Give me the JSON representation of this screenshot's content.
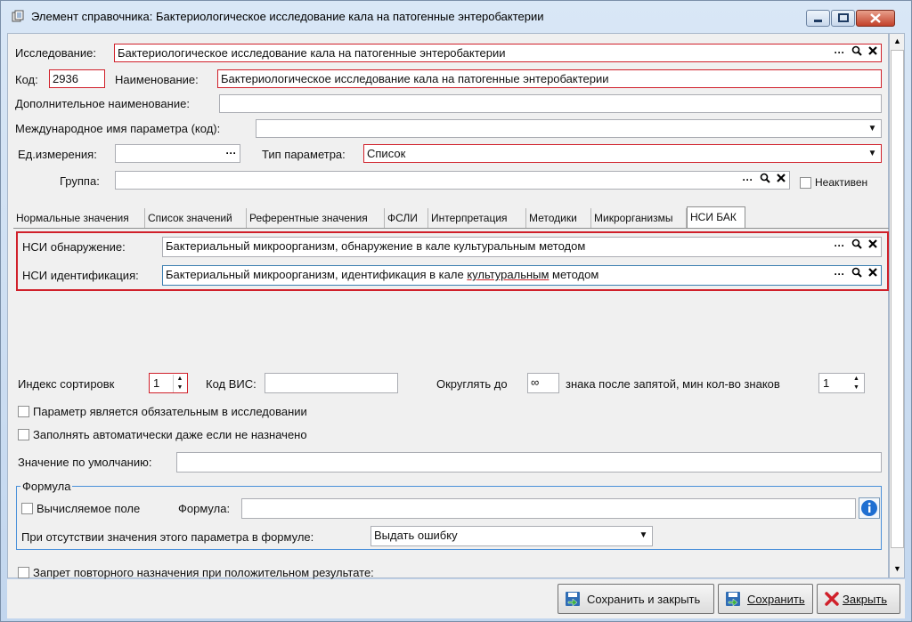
{
  "window": {
    "title": "Элемент справочника: Бактериологическое исследование кала на патогенные энтеробактерии"
  },
  "header": {
    "research_label": "Исследование:",
    "research_value": "Бактериологическое исследование кала на патогенные энтеробактерии",
    "code_label": "Код:",
    "code_value": "2936",
    "name_label": "Наименование:",
    "name_value": "Бактериологическое исследование кала на патогенные энтеробактерии",
    "additional_name_label": "Дополнительное наименование:",
    "additional_name_value": "",
    "intl_name_label": "Международное имя параметра (код):",
    "intl_name_value": "",
    "unit_label": "Ед.измерения:",
    "unit_value": "",
    "param_type_label": "Тип параметра:",
    "param_type_value": "Список",
    "group_label": "Группа:",
    "group_value": "",
    "inactive_label": "Неактивен"
  },
  "tabs": [
    {
      "label": "Нормальные значения"
    },
    {
      "label": "Список значений"
    },
    {
      "label": "Референтные значения"
    },
    {
      "label": "ФСЛИ"
    },
    {
      "label": "Интерпретация"
    },
    {
      "label": "Методики"
    },
    {
      "label": "Микрорганизмы"
    },
    {
      "label": "НСИ БАК"
    }
  ],
  "nsi": {
    "detection_label": "НСИ обнаружение:",
    "detection_value": "Бактериальный микроорганизм, обнаружение в кале культуральным методом",
    "identification_label": "НСИ идентификация:",
    "identification_value_pre": "Бактериальный микроорганизм, идентификация в кале ",
    "identification_value_word": "культуральным",
    "identification_value_post": " методом"
  },
  "sorting": {
    "sort_index_label": "Индекс сортировк",
    "sort_index_value": "1",
    "vis_code_label": "Код ВИС:",
    "vis_code_value": "",
    "round_label": "Округлять до",
    "round_value": "∞",
    "decimals_label": "знака после запятой, мин кол-во знаков",
    "min_digits_value": "1"
  },
  "options": {
    "required_label": "Параметр является обязательным в исследовании",
    "autofill_label": "Заполнять автоматически даже если не назначено",
    "default_value_label": "Значение по умолчанию:",
    "default_value": ""
  },
  "formula": {
    "group_title": "Формула",
    "calculated_label": "Вычисляемое поле",
    "formula_label": "Формула:",
    "formula_value": "",
    "missing_label": "При отсутствии значения этого параметра в формуле:",
    "missing_value": "Выдать ошибку"
  },
  "bottom": {
    "no_repeat_label": "Запрет повторного назначения при положительном результате:"
  },
  "buttons": {
    "save_close": "Сохранить и закрыть",
    "save": "Сохранить",
    "close": "Закрыть"
  },
  "icons": {
    "ellipsis": "···",
    "search": "🔍",
    "clear": "✕"
  }
}
